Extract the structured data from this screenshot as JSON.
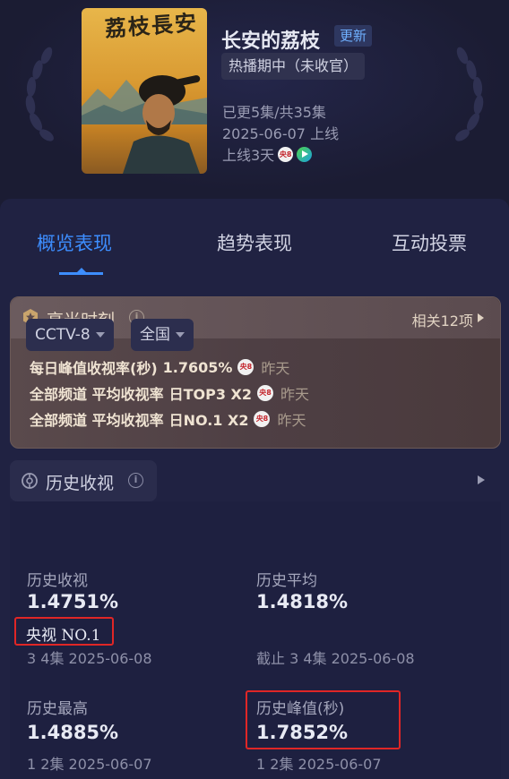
{
  "header": {
    "poster_title_art": "荔枝長安",
    "show_title": "长安的荔枝",
    "update_badge": "更新",
    "status": "热播期中（未收官）",
    "episodes": "已更5集/共35集",
    "launch_date": "2025-06-07 上线",
    "days_online": "上线3天",
    "platform_icons": [
      "cctv8-icon",
      "play-icon"
    ]
  },
  "tabs": [
    {
      "label": "概览表现",
      "active": true
    },
    {
      "label": "趋势表现",
      "active": false
    },
    {
      "label": "互动投票",
      "active": false
    }
  ],
  "highlights": {
    "title": "高光时刻",
    "related": "相关12项",
    "rows": [
      {
        "metric": "每日峰值收视率(秒)",
        "value": "1.7605%",
        "when": "昨天"
      },
      {
        "metric": "全部频道 平均收视率",
        "value": "日TOP3 X2",
        "when": "昨天"
      },
      {
        "metric": "全部频道 平均收视率",
        "value": "日NO.1 X2",
        "when": "昨天"
      }
    ]
  },
  "history": {
    "title": "历史收视",
    "channel": "CCTV-8",
    "region": "全国",
    "stats": {
      "hist_rating": {
        "label": "历史收视",
        "value": "1.4751%",
        "rank": "央视 NO.1",
        "sub": "3 4集 2025-06-08"
      },
      "hist_avg": {
        "label": "历史平均",
        "value": "1.4818%",
        "sub": "截止 3 4集 2025-06-08"
      },
      "hist_high": {
        "label": "历史最高",
        "value": "1.4885%",
        "sub": "1 2集 2025-06-07"
      },
      "hist_peak": {
        "label": "历史峰值(秒)",
        "value": "1.7852%",
        "sub": "1 2集 2025-06-07"
      }
    }
  },
  "colors": {
    "background": "#1b1c33",
    "accent": "#3d8eff",
    "highlight_red": "#e02626"
  }
}
